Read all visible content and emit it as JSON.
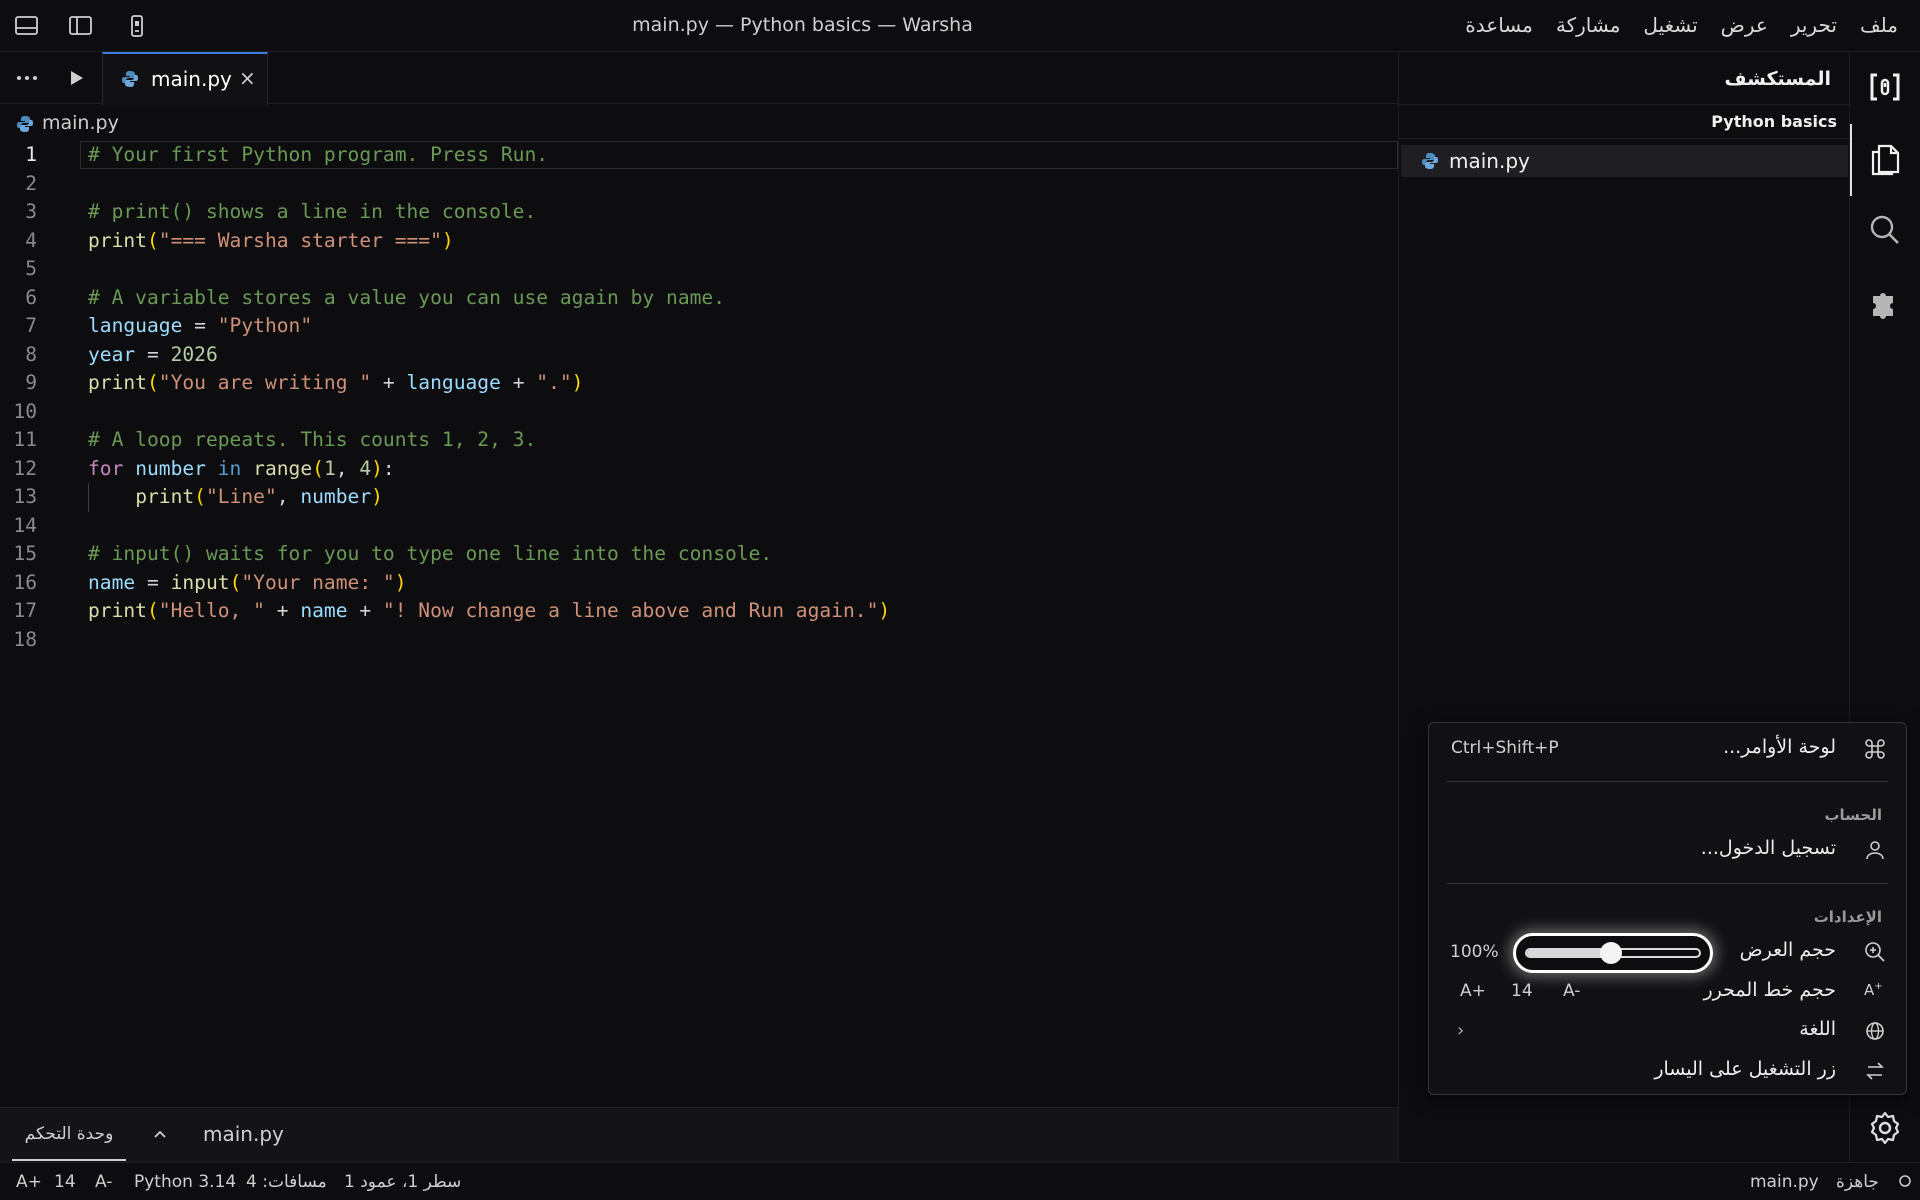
{
  "window": {
    "title": "main.py — Python basics — Warsha"
  },
  "menu": [
    "ملف",
    "تحرير",
    "عرض",
    "تشغيل",
    "مشاركة",
    "مساعدة"
  ],
  "editor": {
    "tab_label": "main.py",
    "tab_close": "×",
    "breadcrumb": "main.py",
    "lines": [
      "# Your first Python program. Press Run.",
      "",
      "# print() shows a line in the console.",
      "print(\"=== Warsha starter ===\")",
      "",
      "# A variable stores a value you can use again by name.",
      "language = \"Python\"",
      "year = 2026",
      "print(\"You are writing \" + language + \".\")",
      "",
      "# A loop repeats. This counts 1, 2, 3.",
      "for number in range(1, 4):",
      "    print(\"Line\", number)",
      "",
      "# input() waits for you to type one line into the console.",
      "name = input(\"Your name: \")",
      "print(\"Hello, \" + name + \"! Now change a line above and Run again.\")",
      ""
    ],
    "line_numbers": [
      "1",
      "2",
      "3",
      "4",
      "5",
      "6",
      "7",
      "8",
      "9",
      "10",
      "11",
      "12",
      "13",
      "14",
      "15",
      "16",
      "17",
      "18"
    ],
    "active_line": 1
  },
  "panel": {
    "console_tab": "وحدة التحكم",
    "file": "main.py"
  },
  "statusbar": {
    "ready": "جاهزة",
    "file": "main.py",
    "position": "سطر 1، عمود 1",
    "spaces": "مسافات: 4",
    "python": "Python 3.14",
    "font_decrease": "A-",
    "font_size": "14",
    "font_increase": "A+"
  },
  "sidebar": {
    "title": "المستكشف",
    "project": "Python basics",
    "files": [
      "main.py"
    ]
  },
  "popup": {
    "command_palette": "لوحة الأوامر...",
    "command_palette_shortcut": "Ctrl+Shift+P",
    "account_section": "الحساب",
    "sign_in": "تسجيل الدخول...",
    "settings_section": "الإعدادات",
    "zoom_label": "حجم العرض",
    "zoom_value": "100%",
    "zoom_level": 0.5,
    "editor_font_label": "حجم خط المحرر",
    "editor_font_decrease": "A-",
    "editor_font_size": "14",
    "editor_font_increase": "A+",
    "language_label": "اللغة",
    "language_chevron": "‹",
    "run_button_label": "زر التشغيل على اليسار"
  },
  "icons": {
    "titlebar": [
      "panel-bottom-icon",
      "sidebar-left-icon",
      "phone-icon"
    ],
    "activity": [
      "warsha-logo-icon",
      "files-icon",
      "search-icon",
      "extensions-icon",
      "gear-icon"
    ]
  },
  "colors": {
    "accent": "#3b7ddd",
    "comment": "#6a9955",
    "string": "#ce9178",
    "function": "#dcdcaa",
    "variable": "#9cdcfe"
  }
}
